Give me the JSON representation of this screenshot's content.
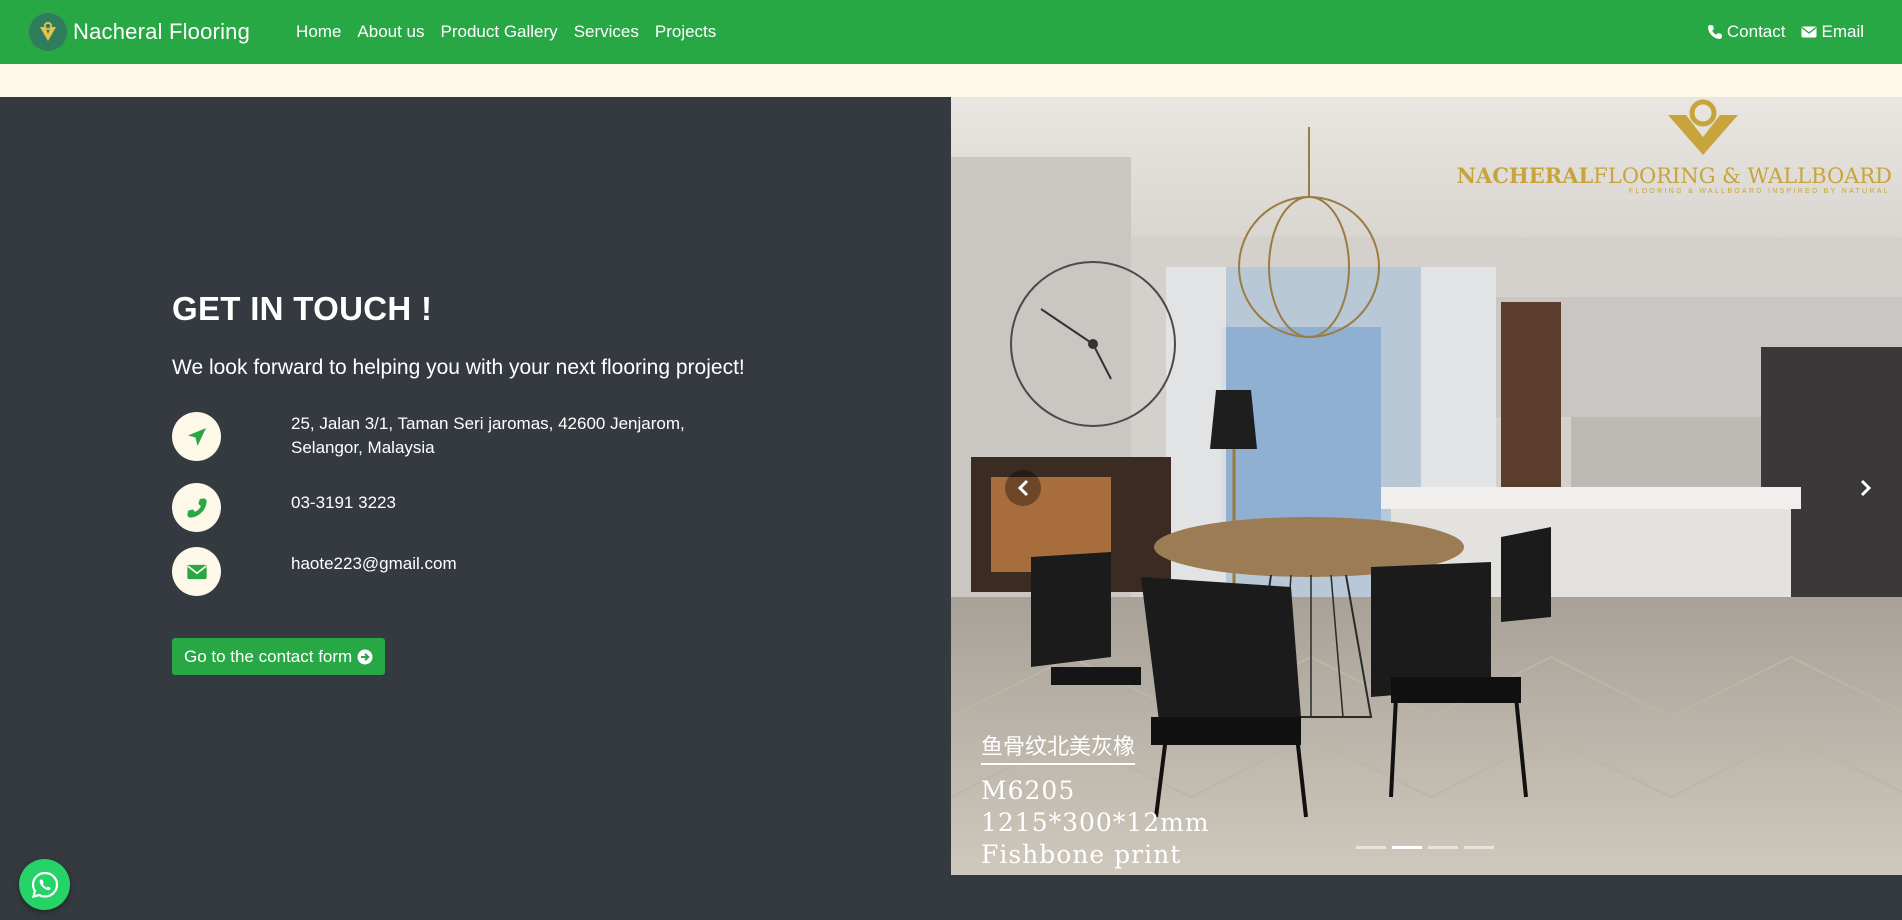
{
  "navbar": {
    "brand": "Nacheral Flooring",
    "links": [
      "Home",
      "About us",
      "Product Gallery",
      "Services",
      "Projects"
    ],
    "contact_label": "Contact",
    "email_label": "Email"
  },
  "contact": {
    "heading": "GET IN TOUCH !",
    "subtitle": "We look forward to helping you with your next flooring project!",
    "address_line1": "25, Jalan 3/1, Taman Seri jaromas, 42600 Jenjarom,",
    "address_line2": "Selangor, Malaysia",
    "phone": "03-3191 3223",
    "email": "haote223@gmail.com",
    "cta_label": "Go to the contact form"
  },
  "carousel": {
    "watermark_brand_bold": "NACHERAL",
    "watermark_brand_rest": "FLOORING & WALLBOARD",
    "watermark_tagline": "FLOORING & WALLBOARD INSPIRED BY NATURAL",
    "caption_cn": "鱼骨纹北美灰橡",
    "caption_code": "M6205",
    "caption_size": "1215*300*12mm",
    "caption_print": "Fishbone print",
    "slide_count": 4,
    "active_slide": 2
  },
  "icons": {
    "brand_logo": "leaf-logo-icon",
    "contact": "phone-icon",
    "email": "envelope-icon",
    "address": "location-arrow-icon",
    "cta": "arrow-circle-right-icon",
    "prev": "chevron-left-icon",
    "next": "chevron-right-icon",
    "whatsapp": "whatsapp-icon"
  },
  "colors": {
    "accent": "#28a745",
    "background": "#343a40",
    "cream": "#fdf8e8",
    "gold": "#c7a43c"
  }
}
